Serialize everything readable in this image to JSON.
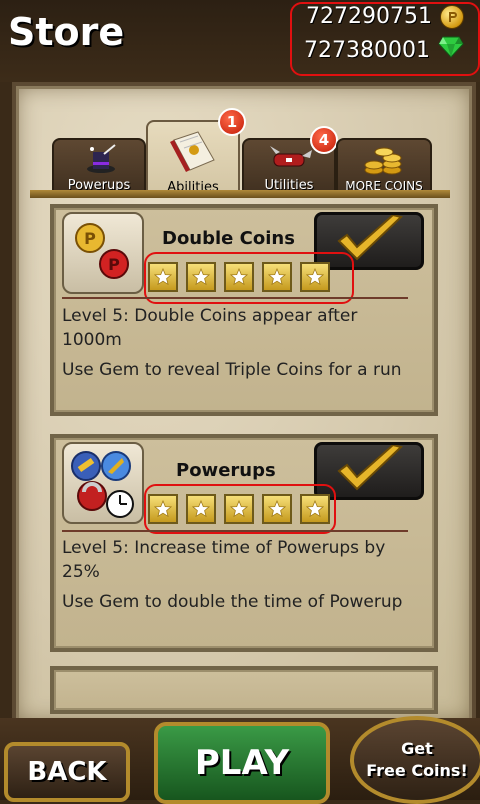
{
  "screen": {
    "title": "Store"
  },
  "currency": {
    "coins": "727290751",
    "gems": "727380001"
  },
  "tabs": [
    {
      "label": "Powerups",
      "icon": "magic-hat-icon",
      "badge": null,
      "active": false
    },
    {
      "label": "Abilities",
      "icon": "spellbook-icon",
      "badge": "1",
      "active": true
    },
    {
      "label": "Utilities",
      "icon": "pocket-knife-icon",
      "badge": "4",
      "active": false
    },
    {
      "label": "MORE COINS",
      "icon": "coin-pile-icon",
      "badge": null,
      "active": false
    }
  ],
  "items": [
    {
      "title": "Double Coins",
      "icon": "double-coins-icon",
      "purchased": true,
      "stars_filled": 5,
      "stars_total": 5,
      "description": "Level 5: Double Coins appear after 1000m",
      "gem_text": "Use Gem to reveal Triple Coins for a run"
    },
    {
      "title": "Powerups",
      "icon": "powerups-timer-icon",
      "purchased": true,
      "stars_filled": 5,
      "stars_total": 5,
      "description": "Level 5: Increase time of Powerups by 25%",
      "gem_text": "Use Gem to double the time of Powerup"
    }
  ],
  "buttons": {
    "back": "BACK",
    "play": "PLAY",
    "free_coins_line1": "Get",
    "free_coins_line2": "Free Coins!"
  },
  "colors": {
    "highlight": "#e01010",
    "gold": "#d49a12",
    "gem": "#2ecc40",
    "play": "#2e8a3a"
  }
}
